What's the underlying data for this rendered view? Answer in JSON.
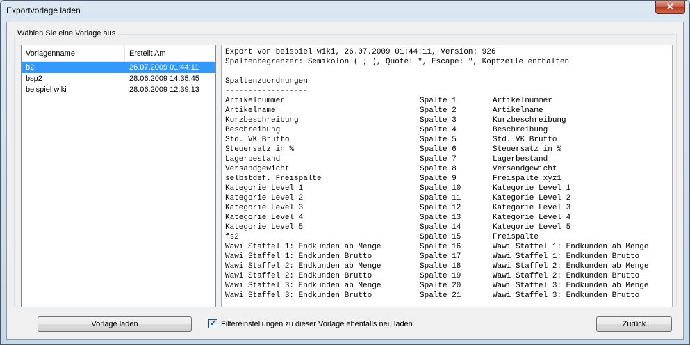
{
  "window": {
    "title": "Exportvorlage laden",
    "close_glyph": "✕"
  },
  "group": {
    "legend": "Wählen Sie eine Vorlage aus"
  },
  "list": {
    "headers": [
      "Vorlagenname",
      "Erstellt Am"
    ],
    "rows": [
      {
        "name": "b2",
        "date": "26.07.2009 01:44:11",
        "selected": true
      },
      {
        "name": "bsp2",
        "date": "28.06.2009 14:35:45",
        "selected": false
      },
      {
        "name": "beispiel wiki",
        "date": "28.06.2009 12:39:13",
        "selected": false
      }
    ]
  },
  "details": {
    "header_line1": "Export von beispiel wiki, 26.07.2009 01:44:11, Version: 926",
    "header_line2": "Spaltenbegrenzer: Semikolon ( ; ), Quote: \", Escape: \", Kopfzeile enthalten",
    "section_title": "Spaltenzuordnungen",
    "section_rule": "------------------",
    "mappings": [
      [
        "Artikelnummer",
        "Spalte 1",
        "Artikelnummer"
      ],
      [
        "Artikelname",
        "Spalte 2",
        "Artikelname"
      ],
      [
        "Kurzbeschreibung",
        "Spalte 3",
        "Kurzbeschreibung"
      ],
      [
        "Beschreibung",
        "Spalte 4",
        "Beschreibung"
      ],
      [
        "Std. VK Brutto",
        "Spalte 5",
        "Std. VK Brutto"
      ],
      [
        "Steuersatz in %",
        "Spalte 6",
        "Steuersatz in %"
      ],
      [
        "Lagerbestand",
        "Spalte 7",
        "Lagerbestand"
      ],
      [
        "Versandgewicht",
        "Spalte 8",
        "Versandgewicht"
      ],
      [
        "selbstdef. Freispalte",
        "Spalte 9",
        "Freispalte xyz1"
      ],
      [
        "Kategorie Level 1",
        "Spalte 10",
        "Kategorie Level 1"
      ],
      [
        "Kategorie Level 2",
        "Spalte 11",
        "Kategorie Level 2"
      ],
      [
        "Kategorie Level 3",
        "Spalte 12",
        "Kategorie Level 3"
      ],
      [
        "Kategorie Level 4",
        "Spalte 13",
        "Kategorie Level 4"
      ],
      [
        "Kategorie Level 5",
        "Spalte 14",
        "Kategorie Level 5"
      ],
      [
        "fs2",
        "Spalte 15",
        "Freispalte"
      ],
      [
        "Wawi Staffel 1: Endkunden ab Menge",
        "Spalte 16",
        "Wawi Staffel 1: Endkunden ab Menge"
      ],
      [
        "Wawi Staffel 1: Endkunden Brutto",
        "Spalte 17",
        "Wawi Staffel 1: Endkunden Brutto"
      ],
      [
        "Wawi Staffel 2: Endkunden ab Menge",
        "Spalte 18",
        "Wawi Staffel 2: Endkunden ab Menge"
      ],
      [
        "Wawi Staffel 2: Endkunden Brutto",
        "Spalte 19",
        "Wawi Staffel 2: Endkunden Brutto"
      ],
      [
        "Wawi Staffel 3: Endkunden ab Menge",
        "Spalte 20",
        "Wawi Staffel 3: Endkunden ab Menge"
      ],
      [
        "Wawi Staffel 3: Endkunden Brutto",
        "Spalte 21",
        "Wawi Staffel 3: Endkunden Brutto"
      ]
    ]
  },
  "footer": {
    "load_button": "Vorlage laden",
    "checkbox_label": "Filtereinstellungen zu dieser Vorlage ebenfalls neu laden",
    "checkbox_checked": true,
    "back_button": "Zurück"
  },
  "colors": {
    "selection": "#3399ff",
    "window_chrome": "#c8d8e8",
    "close_button": "#c75a44"
  }
}
